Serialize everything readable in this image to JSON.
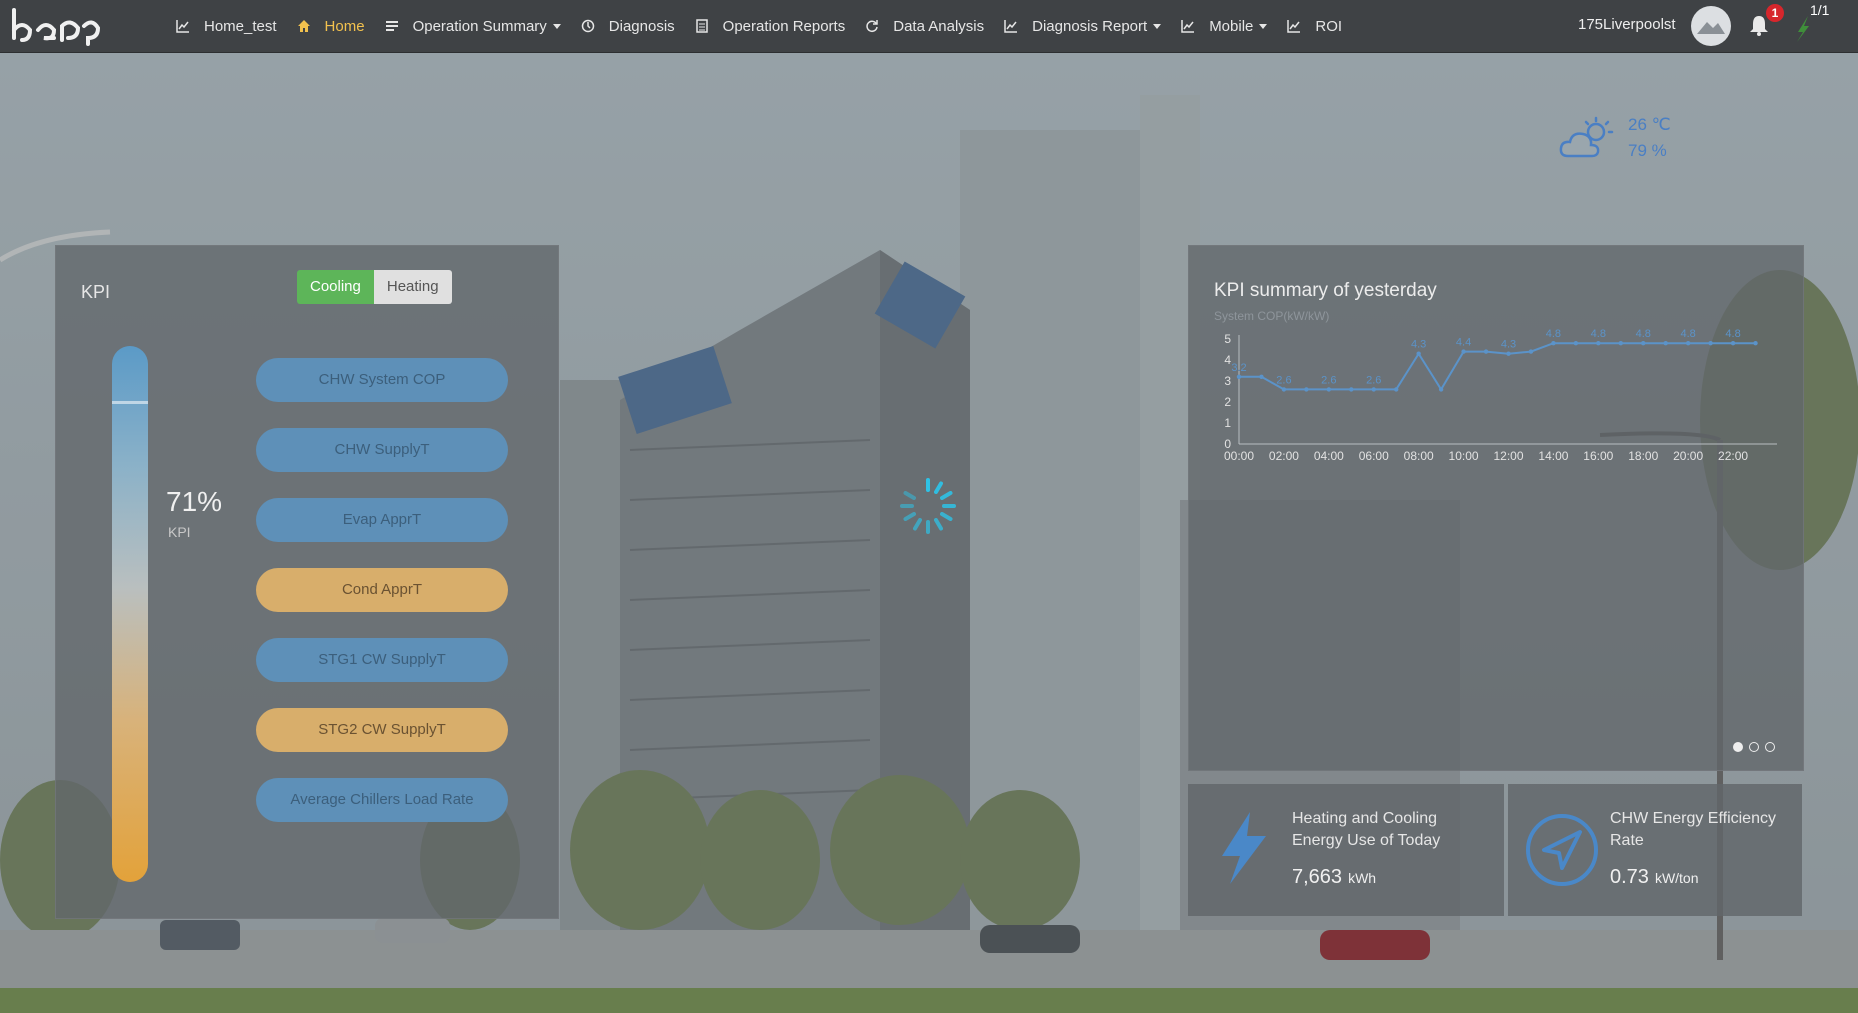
{
  "header": {
    "nav": [
      {
        "label": "Home_test",
        "icon": "line-chart-icon"
      },
      {
        "label": "Home",
        "icon": "home-icon",
        "active": true
      },
      {
        "label": "Operation Summary",
        "icon": "list-icon",
        "dropdown": true
      },
      {
        "label": "Diagnosis",
        "icon": "clock-icon"
      },
      {
        "label": "Operation Reports",
        "icon": "document-icon"
      },
      {
        "label": "Data Analysis",
        "icon": "refresh-icon"
      },
      {
        "label": "Diagnosis Report",
        "icon": "line-chart-icon",
        "dropdown": true
      },
      {
        "label": "Mobile",
        "icon": "line-chart-icon",
        "dropdown": true
      },
      {
        "label": "ROI",
        "icon": "line-chart-icon"
      }
    ],
    "user_name": "175Liverpoolst",
    "notification_count": "1",
    "page_indicator": "1/1"
  },
  "weather": {
    "temperature": "26 ℃",
    "humidity": "79 %",
    "icon": "partly-cloudy-icon"
  },
  "kpi": {
    "title": "KPI",
    "mode_cooling": "Cooling",
    "mode_heating": "Heating",
    "active_mode": "Cooling",
    "percent": "71%",
    "percent_value": 0.71,
    "sublabel": "KPI",
    "items": [
      {
        "label": "CHW System COP",
        "status": "blue"
      },
      {
        "label": "CHW SupplyT",
        "status": "blue"
      },
      {
        "label": "Evap ApprT",
        "status": "blue"
      },
      {
        "label": "Cond ApprT",
        "status": "gold"
      },
      {
        "label": "STG1 CW SupplyT",
        "status": "blue"
      },
      {
        "label": "STG2 CW SupplyT",
        "status": "gold"
      },
      {
        "label": "Average Chillers Load Rate",
        "status": "blue"
      }
    ]
  },
  "summary": {
    "title": "KPI summary of yesterday",
    "ylabel": "System COP(kW/kW)"
  },
  "chart_data": {
    "type": "line",
    "title": "KPI summary of yesterday",
    "ylabel": "System COP(kW/kW)",
    "xlabel": "",
    "ylim": [
      0,
      5
    ],
    "yticks": [
      "0",
      "1",
      "2",
      "3",
      "4",
      "5"
    ],
    "xticks": [
      "00:00",
      "02:00",
      "04:00",
      "06:00",
      "08:00",
      "10:00",
      "12:00",
      "14:00",
      "16:00",
      "18:00",
      "20:00",
      "22:00"
    ],
    "x": [
      0,
      1,
      2,
      3,
      4,
      5,
      6,
      7,
      8,
      9,
      10,
      11,
      12,
      13,
      14,
      15,
      16,
      17,
      18,
      19,
      20,
      21,
      22,
      23
    ],
    "values": [
      3.2,
      3.2,
      2.6,
      2.6,
      2.6,
      2.6,
      2.6,
      2.6,
      4.3,
      2.6,
      4.4,
      4.4,
      4.3,
      4.4,
      4.8,
      4.8,
      4.8,
      4.8,
      4.8,
      4.8,
      4.8,
      4.8,
      4.8,
      4.8
    ],
    "data_labels": [
      {
        "x": 0,
        "text": "3.2"
      },
      {
        "x": 2,
        "text": "2.6"
      },
      {
        "x": 4,
        "text": "2.6"
      },
      {
        "x": 6,
        "text": "2.6"
      },
      {
        "x": 8,
        "text": "4.3"
      },
      {
        "x": 10,
        "text": "4.4"
      },
      {
        "x": 12,
        "text": "4.3"
      },
      {
        "x": 14,
        "text": "4.8"
      },
      {
        "x": 16,
        "text": "4.8"
      },
      {
        "x": 18,
        "text": "4.8"
      },
      {
        "x": 20,
        "text": "4.8"
      },
      {
        "x": 22,
        "text": "4.8"
      }
    ],
    "line_color": "#5b93c9",
    "grid": false
  },
  "energy_card": {
    "title_line1": "Heating and Cooling",
    "title_line2": "Energy Use of Today",
    "value": "7,663",
    "unit": "kWh",
    "icon": "lightning-icon"
  },
  "efficiency_card": {
    "title_line1": "CHW Energy Efficiency",
    "title_line2": "Rate",
    "value": "0.73",
    "unit": "kW/ton",
    "icon": "navigation-icon"
  },
  "carousel": {
    "count": 3,
    "active": 0
  },
  "colors": {
    "cooling_active": "#5db559",
    "kpi_blue": "#5e90b8",
    "kpi_gold": "#d8ae6b",
    "nav_active": "#f2c14e",
    "weather_text": "#4a7fc4"
  }
}
